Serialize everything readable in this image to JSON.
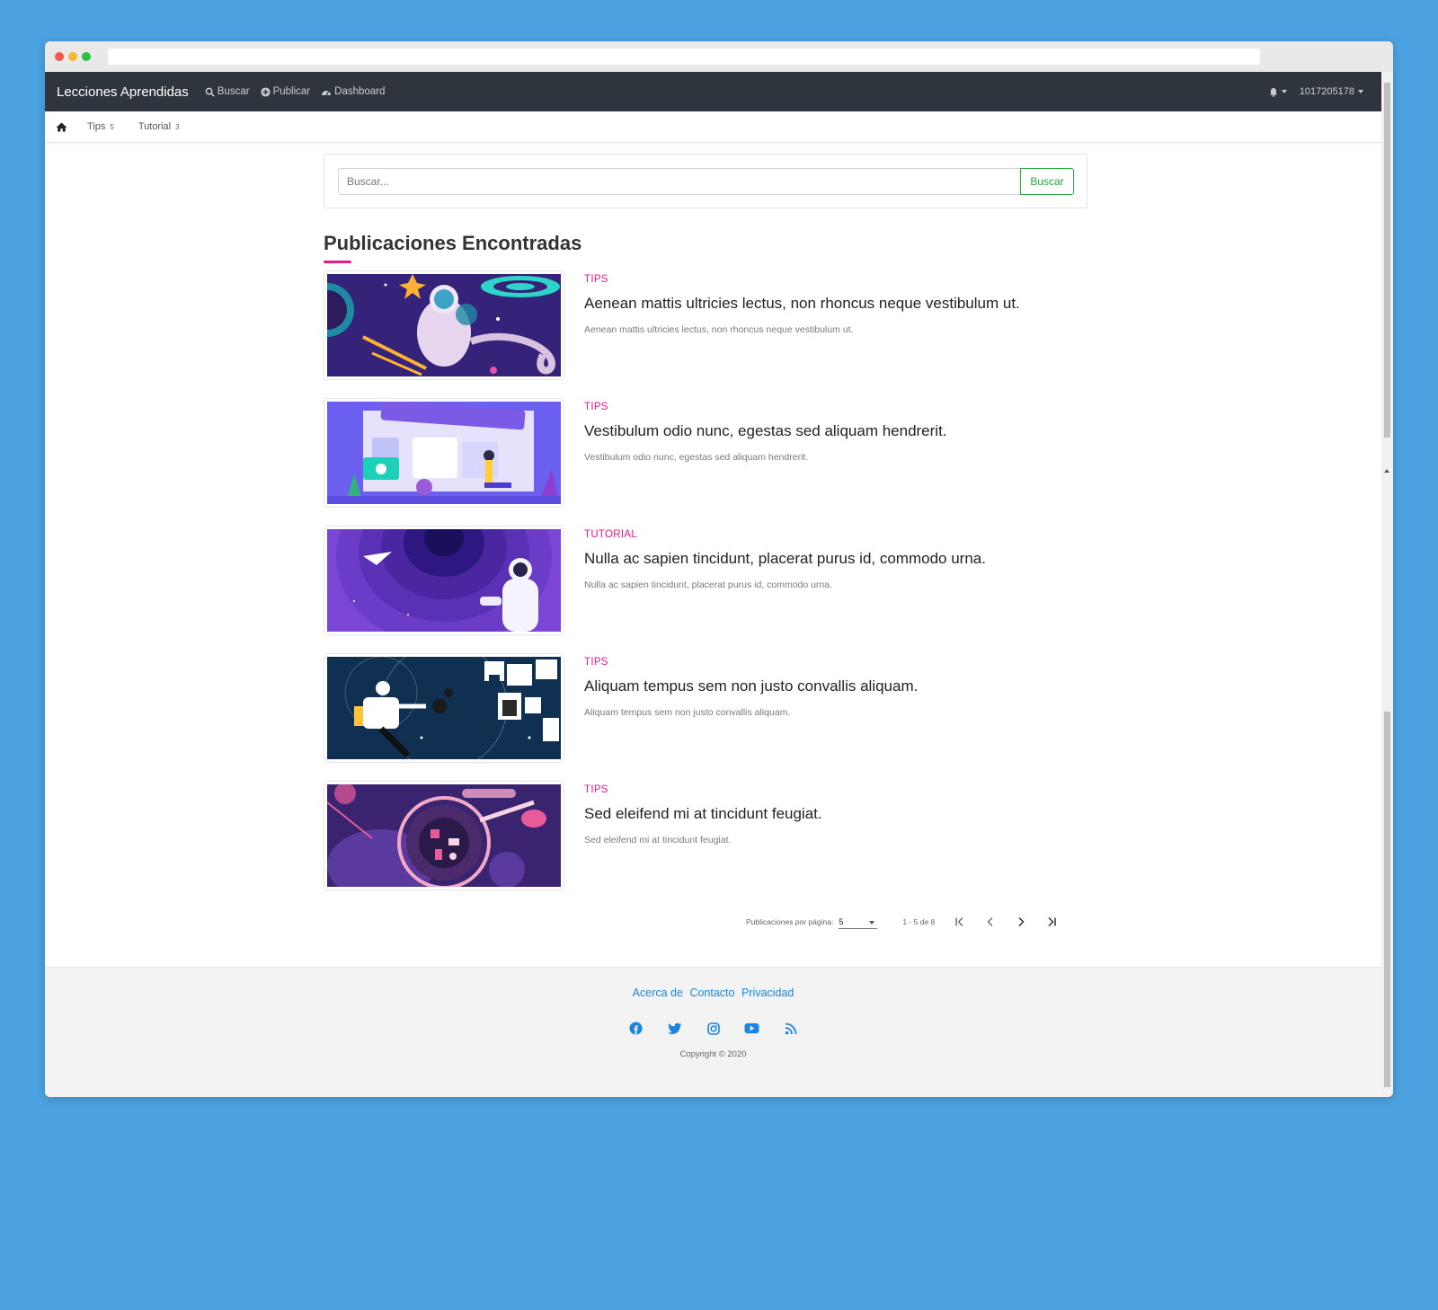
{
  "app": {
    "brand": "Lecciones Aprendidas",
    "nav": [
      {
        "label": "Buscar",
        "icon": "search-icon"
      },
      {
        "label": "Publicar",
        "icon": "plus-circle-icon"
      },
      {
        "label": "Dashboard",
        "icon": "dashboard-icon"
      }
    ],
    "user": "1017205178"
  },
  "subnav": {
    "items": [
      {
        "label": "Tips",
        "count": "5"
      },
      {
        "label": "Tutorial",
        "count": "3"
      }
    ]
  },
  "search": {
    "placeholder": "Buscar...",
    "button": "Buscar"
  },
  "main": {
    "title": "Publicaciones Encontradas",
    "posts": [
      {
        "category": "TIPS",
        "title": "Aenean mattis ultricies lectus, non rhoncus neque vestibulum ut.",
        "description": "Aenean mattis ultricies lectus, non rhoncus neque vestibulum ut."
      },
      {
        "category": "TIPS",
        "title": "Vestibulum odio nunc, egestas sed aliquam hendrerit.",
        "description": "Vestibulum odio nunc, egestas sed aliquam hendrerit."
      },
      {
        "category": "TUTORIAL",
        "title": "Nulla ac sapien tincidunt, placerat purus id, commodo urna.",
        "description": "Nulla ac sapien tincidunt, placerat purus id, commodo urna."
      },
      {
        "category": "TIPS",
        "title": "Aliquam tempus sem non justo convallis aliquam.",
        "description": "Aliquam tempus sem non justo convallis aliquam."
      },
      {
        "category": "TIPS",
        "title": "Sed eleifend mi at tincidunt feugiat.",
        "description": "Sed eleifend mi at tincidunt feugiat."
      }
    ]
  },
  "pagination": {
    "per_page_label": "Publicaciones por página:",
    "per_page_value": "5",
    "range": "1 - 5 de 8"
  },
  "footer": {
    "links": [
      "Acerca de",
      "Contacto",
      "Privacidad"
    ],
    "social": [
      "facebook-icon",
      "twitter-icon",
      "instagram-icon",
      "youtube-icon",
      "rss-icon"
    ],
    "copyright": "Copyright © 2020"
  },
  "colors": {
    "accent": "#e61b87",
    "link": "#1a86e0",
    "navbar": "#2f353c",
    "success": "#28a745",
    "background": "#4ca2e0"
  }
}
